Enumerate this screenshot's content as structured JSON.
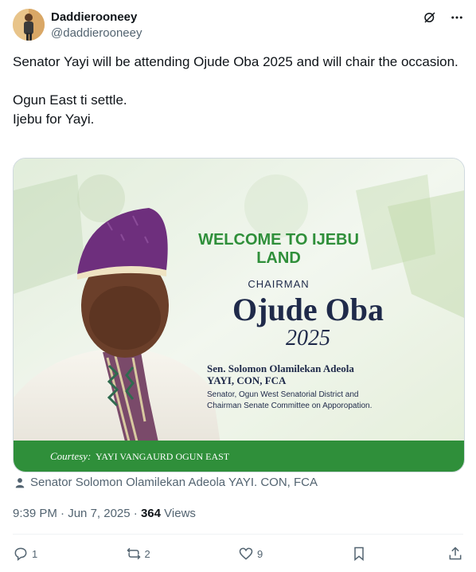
{
  "author": {
    "name": "Daddierooneey",
    "handle": "@daddierooneey"
  },
  "tweet": {
    "text": "Senator Yayi will be attending Ojude Oba 2025 and will chair the occasion.\n\nOgun East ti settle.\nIjebu for Yayi."
  },
  "poster": {
    "welcome_line1": "WELCOME  TO IJEBU",
    "welcome_line2": "LAND",
    "chairman": "CHAIRMAN",
    "event": "Ojude Oba",
    "year": "2025",
    "name_line1": "Sen. Solomon Olamilekan Adeola",
    "name_line2": "YAYI, CON, FCA",
    "role_line1": "Senator, Ogun West Senatorial District and",
    "role_line2": "Chairman Senate Committee on Apporopation.",
    "courtesy_label": "Courtesy:",
    "courtesy_text": "YAYI VANGAURD OGUN EAST",
    "colors": {
      "green": "#2f8f3a",
      "navy": "#1f2a4a",
      "purple": "#6b2a7a"
    }
  },
  "tagged_user": "Senator Solomon Olamilekan Adeola YAYI. CON, FCA",
  "meta": {
    "time": "9:39 PM",
    "dot": "·",
    "date": "Jun 7, 2025",
    "views_count": "364",
    "views_label": "Views"
  },
  "actions": {
    "replies": "1",
    "reposts": "2",
    "likes": "9"
  },
  "icons": [
    "grok-icon",
    "more-icon",
    "reply-icon",
    "repost-icon",
    "like-icon",
    "bookmark-icon",
    "share-icon",
    "person-icon"
  ]
}
